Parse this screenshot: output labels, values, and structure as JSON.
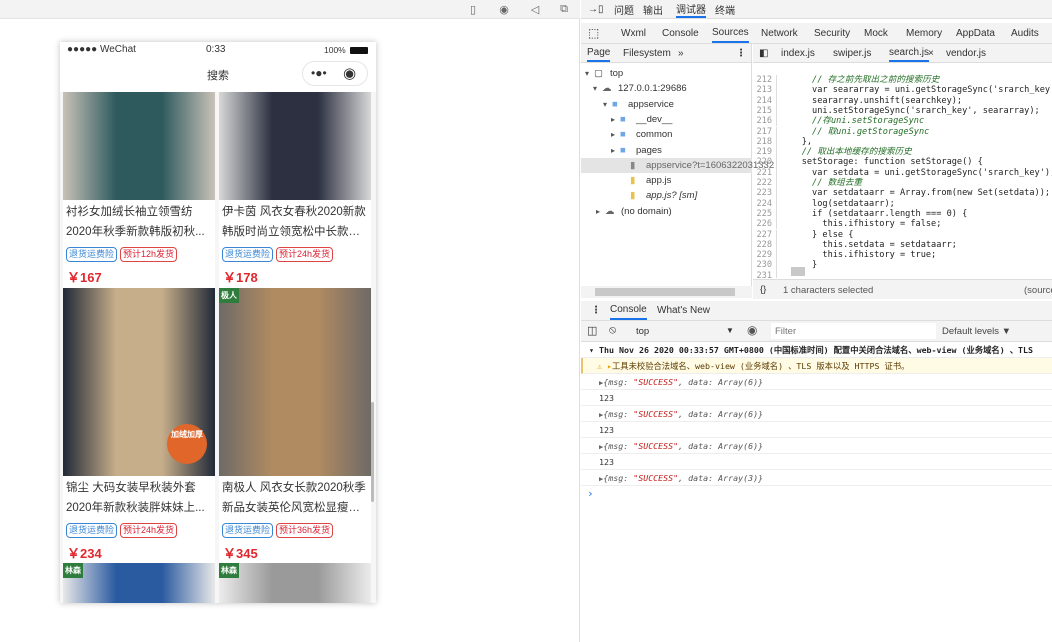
{
  "simulator": {
    "toolbar_icons": [
      "phone-icon",
      "record-icon",
      "volume-icon",
      "window-icon"
    ],
    "status_bar": {
      "carrier": "●●●●● WeChat",
      "time": "0:33",
      "battery": "100%"
    },
    "nav": {
      "title": "搜索",
      "more": "•●•",
      "capsule_close": "◉"
    },
    "products": [
      {
        "line1": "衬衫女加绒长袖立领雪纺",
        "line2": "2020年秋季新款韩版初秋...",
        "tag1": "退货运费险",
        "tag2": "预计12h发货",
        "price": "￥167",
        "colors": [
          "#2e5a5e",
          "#c9c2b8"
        ]
      },
      {
        "line1": "伊卡茵 风衣女春秋2020新款",
        "line2": "韩版时尚立领宽松中长款外...",
        "tag1": "退货运费险",
        "tag2": "预计24h发货",
        "price": "￥178",
        "colors": [
          "#2c3040",
          "#d8d8d8"
        ]
      },
      {
        "line1": "锦尘 大码女装早秋装外套",
        "line2": "2020年新款秋装胖妹妹上...",
        "tag1": "退货运费险",
        "tag2": "预计24h发货",
        "price": "￥234",
        "colors": [
          "#c7ae8a",
          "#222a38"
        ],
        "badge": "加绒加厚"
      },
      {
        "line1": "南极人 风衣女长款2020秋季",
        "line2": "新品女装英伦风宽松显瘦双...",
        "tag1": "退货运费险",
        "tag2": "预计36h发货",
        "price": "￥345",
        "colors": [
          "#b08b62",
          "#6e6a66"
        ],
        "badge": "极人"
      },
      {
        "line1": "",
        "line2": "",
        "colors": [
          "#2a5aa0",
          "#e8e8e8"
        ],
        "badge": "林森"
      },
      {
        "line1": "",
        "line2": "",
        "colors": [
          "#9a9a9a",
          "#ececec"
        ],
        "badge": "林森"
      }
    ]
  },
  "devtools": {
    "top_tabs": [
      "问题",
      "输出",
      "调试器",
      "终端"
    ],
    "main_tabs": [
      "Wxml",
      "Console",
      "Sources",
      "Network",
      "Security",
      "Mock",
      "Memory",
      "AppData",
      "Audits"
    ],
    "nav_tabs": [
      "Page",
      "Filesystem",
      "»"
    ],
    "file_tabs": [
      "index.js",
      "swiper.js",
      "search.js",
      "vendor.js"
    ],
    "tree": [
      "top",
      "127.0.0.1:29686",
      "appservice",
      "__dev__",
      "common",
      "pages",
      "appservice?t=1606322031332",
      "app.js",
      "app.js? [sm]",
      "(no domain)"
    ],
    "code": [
      {
        "n": "212",
        "t": "      // 存之前先取出之前的搜索历史"
      },
      {
        "n": "213",
        "t": "      var seararray = uni.getStorageSync('srarch_key');"
      },
      {
        "n": "214",
        "t": "      seararray.unshift(searchkey);"
      },
      {
        "n": "215",
        "t": "      uni.setStorageSync('srarch_key', seararray);"
      },
      {
        "n": "216",
        "t": "      //存uni.setStorageSync"
      },
      {
        "n": "217",
        "t": "      // 取uni.getStorageSync"
      },
      {
        "n": "218",
        "t": "    },"
      },
      {
        "n": "219",
        "t": "    // 取出本地缓存的搜索历史"
      },
      {
        "n": "220",
        "t": "    setStorage: function setStorage() {"
      },
      {
        "n": "221",
        "t": "      var setdata = uni.getStorageSync('srarch_key');"
      },
      {
        "n": "222",
        "t": "      // 数组去重"
      },
      {
        "n": "223",
        "t": "      var setdataarr = Array.from(new Set(setdata));"
      },
      {
        "n": "224",
        "t": "      log(setdataarr);"
      },
      {
        "n": "225",
        "t": "      if (setdataarr.length === 0) {"
      },
      {
        "n": "226",
        "t": "        this.ifhistory = false;"
      },
      {
        "n": "227",
        "t": "      } else {"
      },
      {
        "n": "228",
        "t": "        this.setdata = setdataarr;"
      },
      {
        "n": "229",
        "t": "        this.ifhistory = true;"
      },
      {
        "n": "230",
        "t": "      }"
      },
      {
        "n": "231",
        "t": ""
      }
    ],
    "status_bar": {
      "braces": "{}",
      "selection": "1 characters selected",
      "source": "(source"
    },
    "drawer_tabs": [
      "Console",
      "What's New"
    ],
    "console_toolbar": {
      "context": "top",
      "filter_placeholder": "Filter",
      "levels": "Default levels ▼"
    },
    "console_logs": {
      "group": "Thu Nov 26 2020 00:33:57 GMT+0800 (中国标准时间) 配置中关闭合法域名、web-view (业务域名) 、TLS",
      "warning": "工具未校验合法域名、web-view (业务域名) 、TLS 版本以及 HTTPS 证书。",
      "entries": [
        {
          "pre": "{msg: ",
          "str": "\"SUCCESS\"",
          "post": ", data: Array(6)}"
        },
        {
          "plain": "123"
        },
        {
          "pre": "{msg: ",
          "str": "\"SUCCESS\"",
          "post": ", data: Array(6)}"
        },
        {
          "plain": "123"
        },
        {
          "pre": "{msg: ",
          "str": "\"SUCCESS\"",
          "post": ", data: Array(6)}"
        },
        {
          "plain": "123"
        },
        {
          "pre": "{msg: ",
          "str": "\"SUCCESS\"",
          "post": ", data: Array(3)}"
        }
      ],
      "prompt": "›"
    }
  }
}
